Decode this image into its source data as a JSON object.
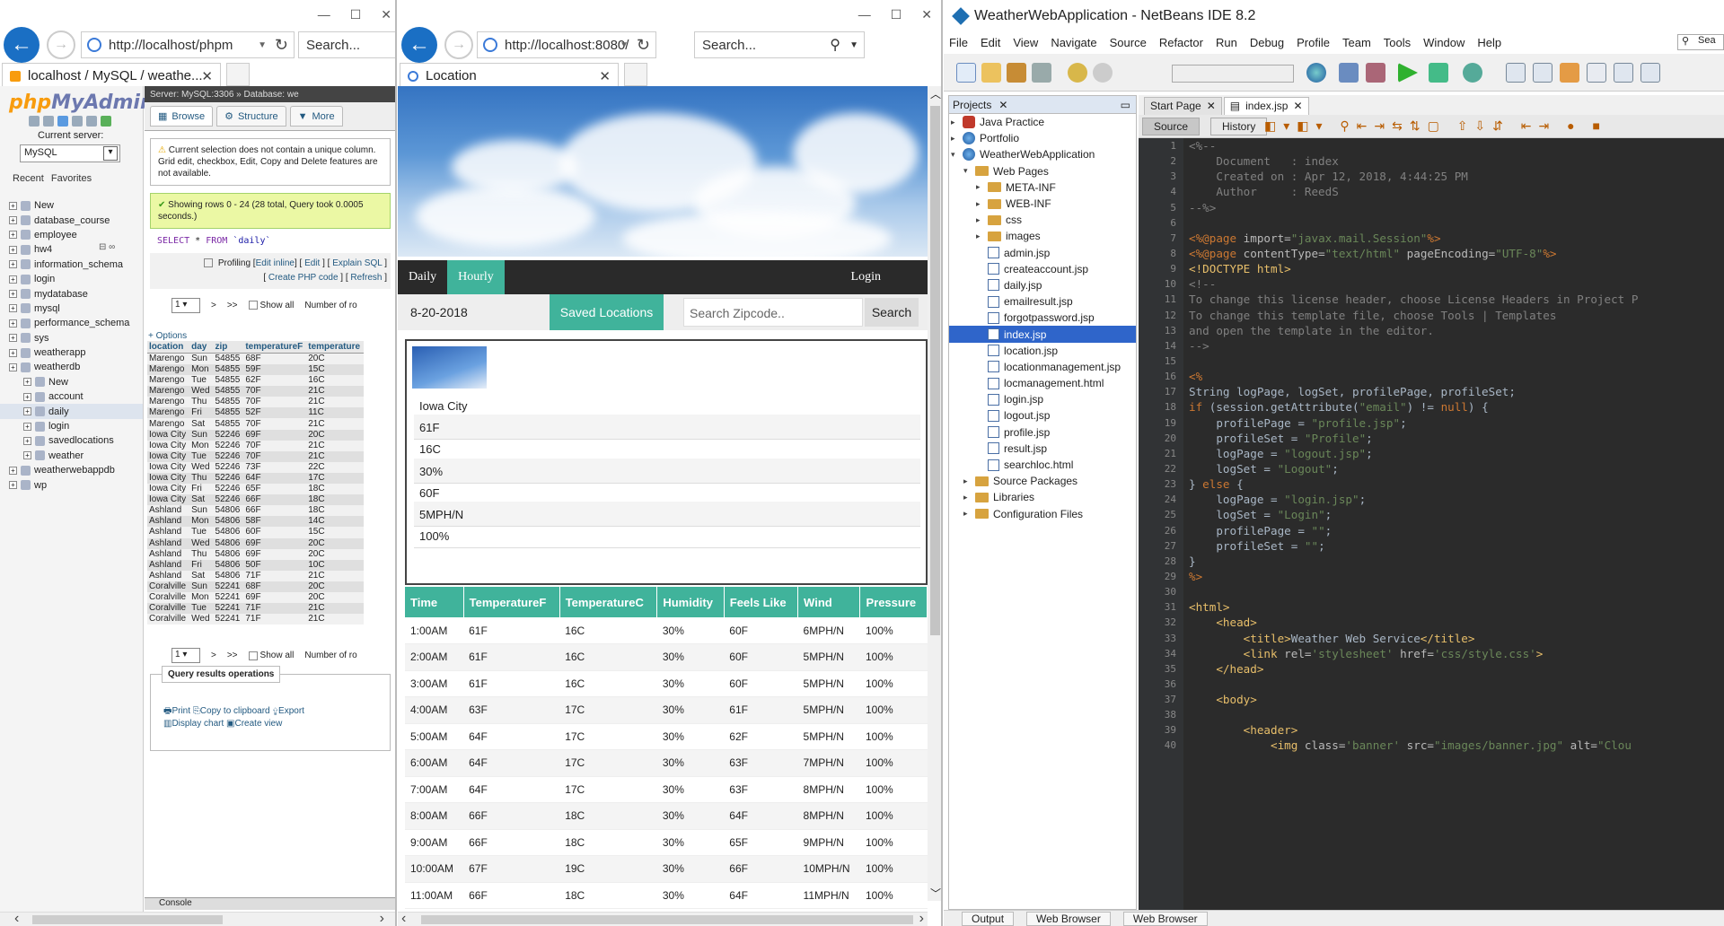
{
  "pma_window": {
    "url": "http://localhost/phpm",
    "search_placeholder": "Search...",
    "tab_title": "localhost / MySQL / weathe...",
    "logo_left": "php",
    "logo_right": "MyAdmin",
    "current_server_label": "Current server:",
    "server_value": "MySQL",
    "recent": "Recent",
    "favorites": "Favorites",
    "tree_new": "New",
    "databases": [
      "database_course",
      "employee",
      "hw4",
      "information_schema",
      "login",
      "mydatabase",
      "mysql",
      "performance_schema",
      "sys",
      "weatherapp",
      "weatherdb"
    ],
    "weatherdb_tables": [
      "New",
      "account",
      "daily",
      "login",
      "savedlocations",
      "weather"
    ],
    "databases_after": [
      "weatherwebappdb",
      "wp"
    ],
    "server_bar": "Server: MySQL:3306 » Database: we",
    "tabs": [
      "Browse",
      "Structure",
      "More"
    ],
    "notice": "Current selection does not contain a unique column. Grid edit, checkbox, Edit, Copy and Delete features are not available.",
    "success": "Showing rows 0 - 24 (28 total, Query took 0.0005 seconds.)",
    "sql_select": "SELECT",
    "sql_star": "*",
    "sql_from": "FROM",
    "sql_table": "`daily`",
    "profiling": "Profiling",
    "edit_inline": "Edit inline",
    "edit": "Edit",
    "explain_sql": "Explain SQL",
    "create_php": "Create PHP code",
    "refresh": "Refresh",
    "page_num": "1",
    "next": ">",
    "last": ">>",
    "show_all": "Show all",
    "num_rows": "Number of ro",
    "options": "+ Options",
    "columns": [
      "location",
      "day",
      "zip",
      "temperatureF",
      "temperature"
    ],
    "rows": [
      [
        "Marengo",
        "Sun",
        "54855",
        "68F",
        "20C"
      ],
      [
        "Marengo",
        "Mon",
        "54855",
        "59F",
        "15C"
      ],
      [
        "Marengo",
        "Tue",
        "54855",
        "62F",
        "16C"
      ],
      [
        "Marengo",
        "Wed",
        "54855",
        "70F",
        "21C"
      ],
      [
        "Marengo",
        "Thu",
        "54855",
        "70F",
        "21C"
      ],
      [
        "Marengo",
        "Fri",
        "54855",
        "52F",
        "11C"
      ],
      [
        "Marengo",
        "Sat",
        "54855",
        "70F",
        "21C"
      ],
      [
        "Iowa City",
        "Sun",
        "52246",
        "69F",
        "20C"
      ],
      [
        "Iowa City",
        "Mon",
        "52246",
        "70F",
        "21C"
      ],
      [
        "Iowa City",
        "Tue",
        "52246",
        "70F",
        "21C"
      ],
      [
        "Iowa City",
        "Wed",
        "52246",
        "73F",
        "22C"
      ],
      [
        "Iowa City",
        "Thu",
        "52246",
        "64F",
        "17C"
      ],
      [
        "Iowa City",
        "Fri",
        "52246",
        "65F",
        "18C"
      ],
      [
        "Iowa City",
        "Sat",
        "52246",
        "66F",
        "18C"
      ],
      [
        "Ashland",
        "Sun",
        "54806",
        "66F",
        "18C"
      ],
      [
        "Ashland",
        "Mon",
        "54806",
        "58F",
        "14C"
      ],
      [
        "Ashland",
        "Tue",
        "54806",
        "60F",
        "15C"
      ],
      [
        "Ashland",
        "Wed",
        "54806",
        "69F",
        "20C"
      ],
      [
        "Ashland",
        "Thu",
        "54806",
        "69F",
        "20C"
      ],
      [
        "Ashland",
        "Fri",
        "54806",
        "50F",
        "10C"
      ],
      [
        "Ashland",
        "Sat",
        "54806",
        "71F",
        "21C"
      ],
      [
        "Coralville",
        "Sun",
        "52241",
        "68F",
        "20C"
      ],
      [
        "Coralville",
        "Mon",
        "52241",
        "69F",
        "20C"
      ],
      [
        "Coralville",
        "Tue",
        "52241",
        "71F",
        "21C"
      ],
      [
        "Coralville",
        "Wed",
        "52241",
        "71F",
        "21C"
      ]
    ],
    "qro_legend": "Query results operations",
    "print": "Print",
    "copy": "Copy to clipboard",
    "export": "Export",
    "display_chart": "Display chart",
    "create_view": "Create view",
    "console": "Console"
  },
  "weather_window": {
    "url": "http://localhost:8080/",
    "search_placeholder": "Search...",
    "tab_title": "Location",
    "nav_daily": "Daily",
    "nav_hourly": "Hourly",
    "nav_login": "Login",
    "date": "8-20-2018",
    "saved_locations": "Saved Locations",
    "zip_placeholder": "Search Zipcode..",
    "search_button": "Search",
    "current": [
      "Iowa City",
      "61F",
      "16C",
      "30%",
      "60F",
      "5MPH/N",
      "100%"
    ],
    "hourly_headers": [
      "Time",
      "TemperatureF",
      "TemperatureC",
      "Humidity",
      "Feels Like",
      "Wind",
      "Pressure"
    ],
    "hourly_rows": [
      [
        "1:00AM",
        "61F",
        "16C",
        "30%",
        "60F",
        "6MPH/N",
        "100%"
      ],
      [
        "2:00AM",
        "61F",
        "16C",
        "30%",
        "60F",
        "5MPH/N",
        "100%"
      ],
      [
        "3:00AM",
        "61F",
        "16C",
        "30%",
        "60F",
        "5MPH/N",
        "100%"
      ],
      [
        "4:00AM",
        "63F",
        "17C",
        "30%",
        "61F",
        "5MPH/N",
        "100%"
      ],
      [
        "5:00AM",
        "64F",
        "17C",
        "30%",
        "62F",
        "5MPH/N",
        "100%"
      ],
      [
        "6:00AM",
        "64F",
        "17C",
        "30%",
        "63F",
        "7MPH/N",
        "100%"
      ],
      [
        "7:00AM",
        "64F",
        "17C",
        "30%",
        "63F",
        "8MPH/N",
        "100%"
      ],
      [
        "8:00AM",
        "66F",
        "18C",
        "30%",
        "64F",
        "8MPH/N",
        "100%"
      ],
      [
        "9:00AM",
        "66F",
        "18C",
        "30%",
        "65F",
        "9MPH/N",
        "100%"
      ],
      [
        "10:00AM",
        "67F",
        "19C",
        "30%",
        "66F",
        "10MPH/N",
        "100%"
      ],
      [
        "11:00AM",
        "66F",
        "18C",
        "30%",
        "64F",
        "11MPH/N",
        "100%"
      ]
    ]
  },
  "netbeans": {
    "title": "WeatherWebApplication - NetBeans IDE 8.2",
    "menu": [
      "File",
      "Edit",
      "View",
      "Navigate",
      "Source",
      "Refactor",
      "Run",
      "Debug",
      "Profile",
      "Team",
      "Tools",
      "Window",
      "Help"
    ],
    "search_placeholder": "Sea",
    "projects_tab": "Projects",
    "tree": {
      "java_practice": "Java Practice",
      "portfolio": "Portfolio",
      "app": "WeatherWebApplication",
      "web_pages": "Web Pages",
      "folders": [
        "META-INF",
        "WEB-INF",
        "css",
        "images"
      ],
      "files": [
        "admin.jsp",
        "createaccount.jsp",
        "daily.jsp",
        "emailresult.jsp",
        "forgotpassword.jsp",
        "index.jsp",
        "location.jsp",
        "locationmanagement.jsp",
        "locmanagement.html",
        "login.jsp",
        "logout.jsp",
        "profile.jsp",
        "result.jsp",
        "searchloc.html"
      ],
      "source_packages": "Source Packages",
      "libraries": "Libraries",
      "config_files": "Configuration Files"
    },
    "editor_tabs": [
      "Start Page",
      "index.jsp"
    ],
    "source_btn": "Source",
    "history_btn": "History",
    "status_tabs": [
      "Output",
      "Web Browser",
      "Web Browser"
    ]
  }
}
